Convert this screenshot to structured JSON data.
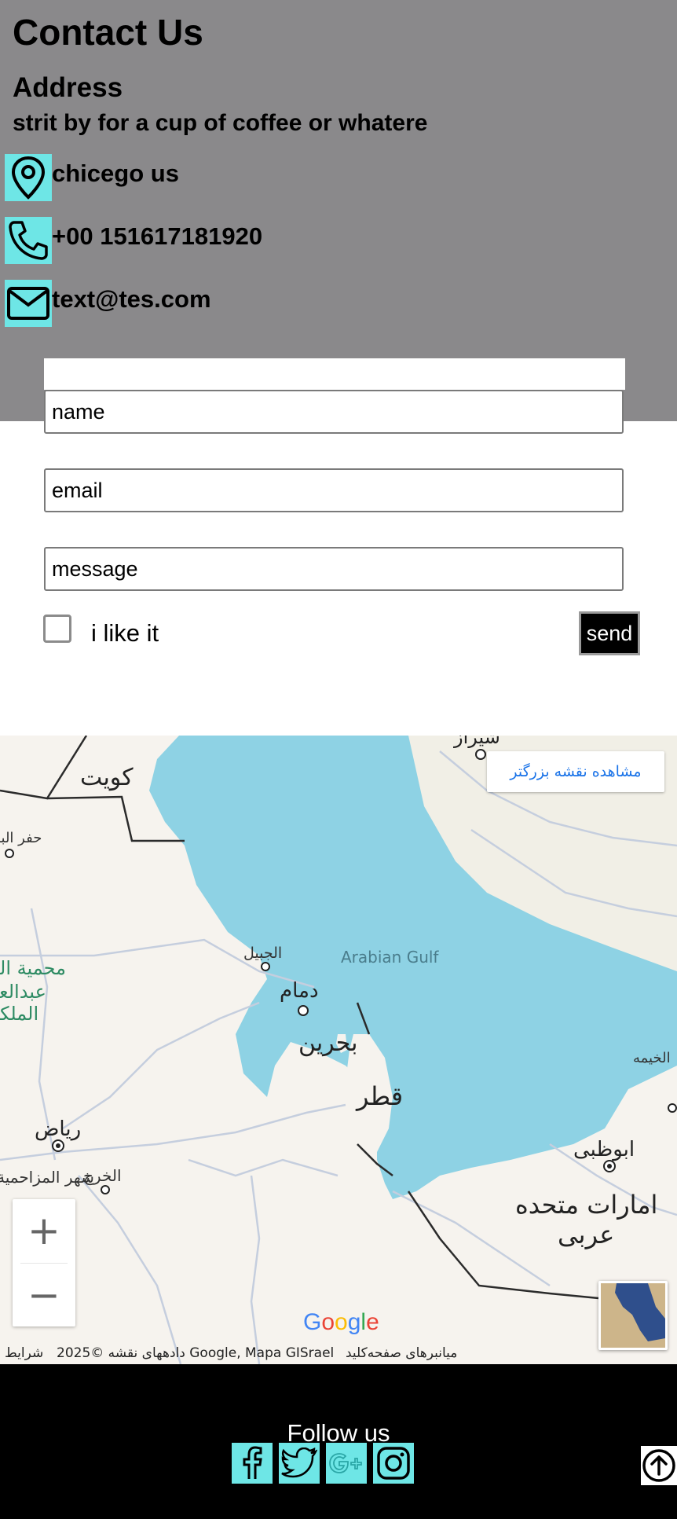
{
  "header": {
    "title": "Contact Us",
    "address_heading": "Address",
    "address_text": "strit by for a cup of coffee or whatere"
  },
  "contact": [
    {
      "icon": "location-pin-icon",
      "text": "chicego us"
    },
    {
      "icon": "phone-icon",
      "text": "+00 151617181920"
    },
    {
      "icon": "envelope-icon",
      "text": "text@tes.com"
    }
  ],
  "form": {
    "name_placeholder": "name",
    "email_placeholder": "email",
    "message_placeholder": "message",
    "checkbox_label": "i like it",
    "send_label": "send"
  },
  "map": {
    "view_larger": "مشاهده نقشه بزرگتر",
    "zoom_in": "+",
    "zoom_out": "−",
    "attribution_terms": "شرایط",
    "attribution_data": "دادههای نقشه ©2025 Google, Mapa GISrael",
    "attribution_shortcuts": "میانبرهای صفحه‌کلید",
    "labels": {
      "kuwait": "كويت",
      "shiraz": "شیراز",
      "hafar": "حفر الباطن",
      "jubail": "الجبیل",
      "arabian_gulf": "Arabian Gulf",
      "reserve1": "محمية الملك",
      "reserve2": "عبدالعزيز",
      "reserve3": "الملكية",
      "dammam": "دمام",
      "bahrain": "بحرين",
      "qatar": "قطر",
      "riyadh": "رياض",
      "kharj": "الخرج",
      "muzahimiyah": "شهر المزاحمية",
      "abu_dhabi": "ابوظبی",
      "uae1": "امارات متحده",
      "uae2": "عربی",
      "ras_khaimah": "الخیمه",
      "google_logo": "Google"
    },
    "colors": {
      "water": "#8ed2e4",
      "land": "#f6f3ee",
      "border": "#2b2b2b",
      "road": "#c5cede"
    }
  },
  "footer": {
    "follow": "Follow us",
    "social": [
      "facebook-icon",
      "twitter-icon",
      "google-plus-icon",
      "instagram-icon"
    ]
  },
  "colors": {
    "header_bg": "#8a898b",
    "accent": "#6ee6e6",
    "footer_bg": "#000000"
  }
}
